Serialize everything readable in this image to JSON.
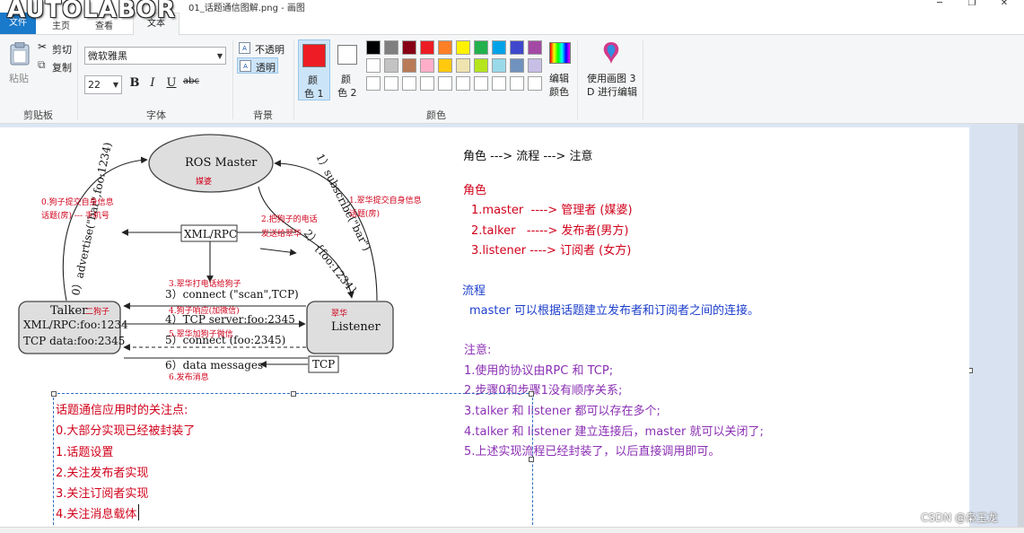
{
  "window": {
    "logo": "AUTOLABOR",
    "title": "01_话题通信图解.png - 画图",
    "minimize": "─",
    "restore": "❐",
    "close": "✕"
  },
  "tabs": {
    "file": "文件",
    "home": "主页",
    "view": "查看",
    "text": "文本"
  },
  "ribbon": {
    "clipboard": {
      "paste": "粘贴",
      "cut": "剪切",
      "copy": "复制",
      "label": "剪贴板"
    },
    "font": {
      "name": "微软雅黑",
      "size": "22",
      "bold": "B",
      "italic": "I",
      "underline": "U",
      "strike": "abc",
      "label": "字体"
    },
    "background": {
      "opaque": "不透明",
      "transparent": "透明",
      "label": "背景"
    },
    "colors": {
      "color1_line1": "颜",
      "color1_line2": "色 1",
      "color2_line1": "颜",
      "color2_line2": "色 2",
      "edit_line1": "编辑",
      "edit_line2": "颜色",
      "paint3d_line1": "使用画图 3",
      "paint3d_line2": "D 进行编辑",
      "label": "颜色",
      "color1_value": "#ee1c24",
      "color2_value": "#ffffff",
      "palette_row1": [
        "#000000",
        "#7f7f7f",
        "#880015",
        "#ed1c24",
        "#ff7f27",
        "#fff200",
        "#22b14c",
        "#00a2e8",
        "#3f48cc",
        "#a349a4"
      ],
      "palette_row2": [
        "#ffffff",
        "#c3c3c3",
        "#b97a57",
        "#ffaec9",
        "#ffc90e",
        "#efe4b0",
        "#b5e61d",
        "#99d9ea",
        "#7092be",
        "#c8bfe7"
      ],
      "palette_row3": [
        "#ffffff",
        "#ffffff",
        "#ffffff",
        "#ffffff",
        "#ffffff",
        "#ffffff",
        "#ffffff",
        "#ffffff",
        "#ffffff",
        "#ffffff"
      ]
    }
  },
  "diagram": {
    "master": "ROS Master",
    "master_note": "媒婆",
    "talker": "Talker",
    "talker_note": "二狗子",
    "talker_line1": "XML/RPC:foo:1234",
    "talker_line2": "TCP data:foo:2345",
    "listener": "Listener",
    "listener_note": "翠华",
    "xmlrpc": "XML/RPC",
    "tcp": "TCP",
    "step0": "0）advertise(\"bar\",foo:1234)",
    "step1": "1）subscribe(\"bar\")",
    "step2": "2）{foo:1234}",
    "step3": "3）connect (\"scan\",TCP)",
    "step4": "4）TCP server:foo:2345",
    "step5": "5）connect (foo:2345)",
    "step6": "6）data messages",
    "note0_line1": "0.狗子提交自身信息",
    "note0_line2": "话题(房) --- 手机号",
    "note1_line1": "1.翠华提交自身信息",
    "note1_line2": "话题(房)",
    "note2_line1": "2.把狗子的电话",
    "note2_line2": "发送给翠华",
    "note3": "3.翠华打电话给狗子",
    "note4": "4.狗子响应(加微信)",
    "note5": "5.翠华加狗子微信",
    "note6": "6.发布消息"
  },
  "notes": {
    "heading": "角色 ---> 流程 ---> 注意",
    "roles_title": "角色",
    "role1": "1.master  ----> 管理者 (媒婆)",
    "role2": "2.talker   -----> 发布者(男方)",
    "role3": "3.listener ----> 订阅者 (女方)",
    "flow_title": "流程",
    "flow_text": "master 可以根据话题建立发布者和订阅者之间的连接。",
    "attention_title": "注意:",
    "att1": "1.使用的协议由RPC 和 TCP;",
    "att2": "2.步骤0和步骤1没有顺序关系;",
    "att3": "3.talker 和 listener 都可以存在多个;",
    "att4": "4.talker 和 listener 建立连接后，master 就可以关闭了;",
    "att5": "5.上述实现流程已经封装了，以后直接调用即可。"
  },
  "textbox": {
    "line0": "话题通信应用时的关注点:",
    "line1": "0.大部分实现已经被封装了",
    "line2": "1.话题设置",
    "line3": "2.关注发布者实现",
    "line4": "3.关注订阅者实现",
    "line5": "4.关注消息载体"
  },
  "watermark": "CSDN @枭玉龙"
}
